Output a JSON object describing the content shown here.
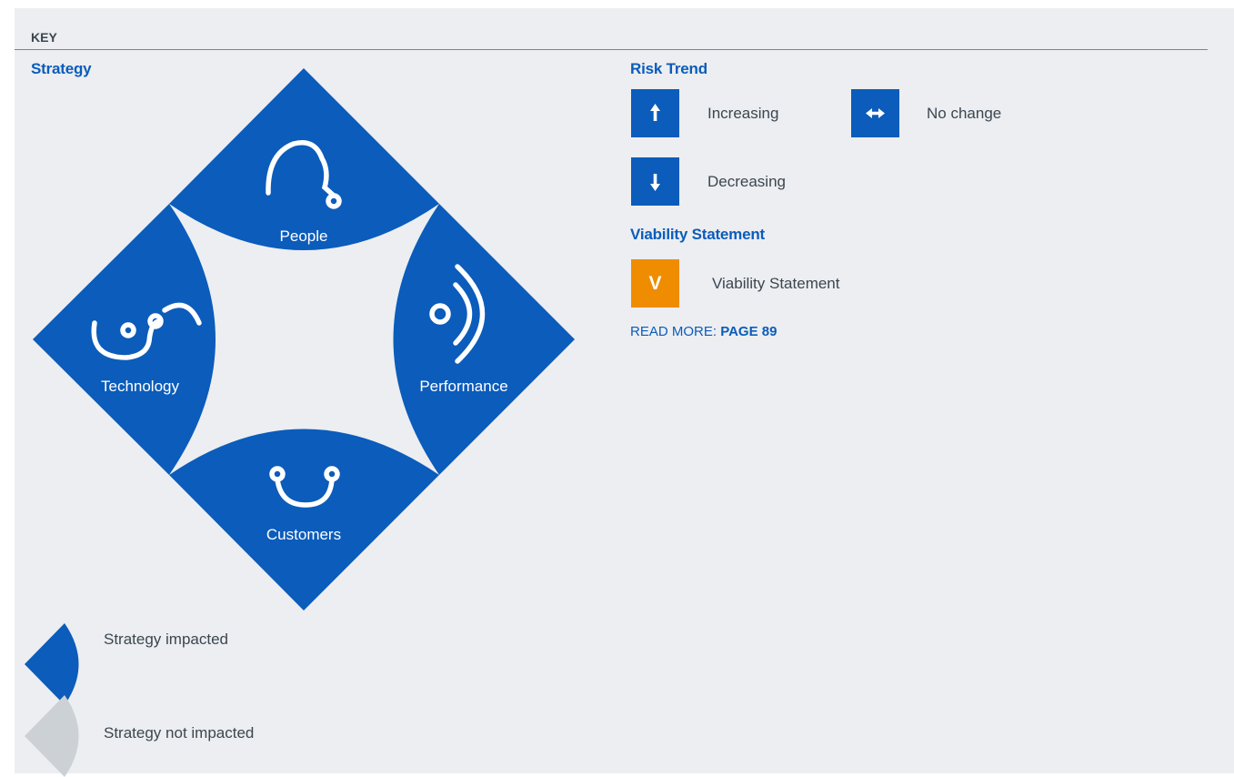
{
  "key": {
    "title": "KEY"
  },
  "strategy": {
    "title": "Strategy",
    "segments": [
      {
        "label": "People"
      },
      {
        "label": "Technology"
      },
      {
        "label": "Performance"
      },
      {
        "label": "Customers"
      }
    ],
    "legend": {
      "impacted": "Strategy impacted",
      "not_impacted": "Strategy not impacted"
    }
  },
  "risk_trend": {
    "title": "Risk Trend",
    "items": [
      {
        "icon": "arrow-up-icon",
        "label": "Increasing"
      },
      {
        "icon": "arrow-left-right-icon",
        "label": "No change"
      },
      {
        "icon": "arrow-down-icon",
        "label": "Decreasing"
      }
    ]
  },
  "viability": {
    "title": "Viability Statement",
    "badge": "V",
    "label": "Viability Statement"
  },
  "read_more": {
    "prefix": "READ MORE: ",
    "page": "PAGE 89"
  },
  "colors": {
    "brand_blue": "#0b5cbb",
    "viability_orange": "#f08c00",
    "not_impacted_grey": "#ccd1d6",
    "background": "#eceef1"
  }
}
